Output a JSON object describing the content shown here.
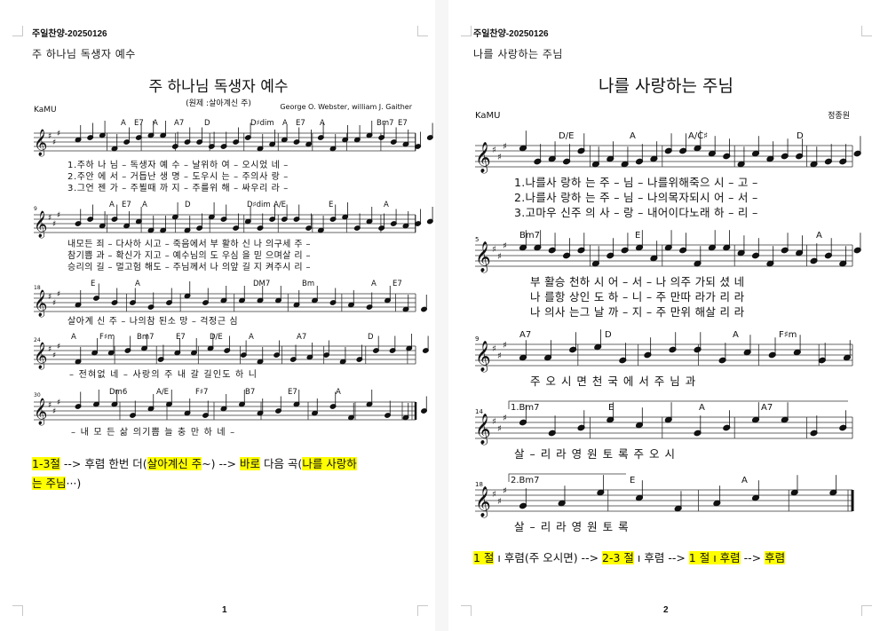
{
  "page1": {
    "header": "주일찬양-20250126",
    "subtitle": "주 하나님 독생자 예수",
    "title": "주 하나님 독생자 예수",
    "original": "(원제 :살아계신 주)",
    "publisher": "KaMU",
    "composer": "George O. Webster, william J. Gaither",
    "measure_numbers": [
      "9",
      "18",
      "24",
      "30"
    ],
    "chords": {
      "row1": [
        "A",
        "E7",
        "A",
        "A7",
        "D",
        "D♯dim",
        "A",
        "E7",
        "A",
        "Bm7",
        "E7"
      ],
      "row2": [
        "A",
        "E7",
        "A",
        "D",
        "D♯dim",
        "A/E",
        "E",
        "A"
      ],
      "row3": [
        "E",
        "A",
        "DM7",
        "Bm",
        "A",
        "E7"
      ],
      "row4": [
        "A",
        "F♯m",
        "Bm7",
        "E7",
        "D/E",
        "A",
        "A7",
        "D"
      ],
      "row5": [
        "Dm6",
        "A/E",
        "F♯7",
        "B7",
        "E7",
        "A"
      ]
    },
    "lyrics": {
      "row1": [
        "1.주하 나 님 – 독생자 예 수 – 날위하 여 – 오시었 네 –",
        "2.주안 에 서 – 거듭난 생 명 – 도우시 는 – 주의사 랑 –",
        "3.그언 젠 가 – 주뵐때 까 지 – 주를위 해 – 싸우리 라 –"
      ],
      "row2": [
        "내모든 죄 – 다사하 시고 – 죽음에서 부 활하 신 나 의구세 주 –",
        "참기쁨 과 – 확신가 지고 – 예수님의 도 우심 을 믿 으며살 리 –",
        "승리의 길 – 멀고험 해도 – 주님께서 나 의앞 길 지 켜주시 리 –"
      ],
      "row3": [
        "살아계 신 주  – 나의참 된소 망 – 걱정근 심"
      ],
      "row4": [
        "– 전혀없 네  – 사랑의 주 내 갈 길인도 하 니"
      ],
      "row5": [
        "– 내 모 든 삶  의기쁨  늘 충 만 하 네 –"
      ]
    },
    "note": {
      "p1": "1-3절",
      "p2": " -->  후렴 한번 더(",
      "p3": "살아계신 주",
      "p4": "~)  -->  ",
      "p5": "바로",
      "p6": " 다음 곡(",
      "p7": "나를 사랑하",
      "p8": "는 주님",
      "p9": "···)"
    },
    "page_number": "1"
  },
  "page2": {
    "header": "주일찬양-20250126",
    "subtitle": "나를 사랑하는 주님",
    "title": "나를 사랑하는 주님",
    "publisher": "KaMU",
    "composer": "정종원",
    "measure_numbers": [
      "5",
      "9",
      "14",
      "18"
    ],
    "chords": {
      "row1": [
        "D/E",
        "A",
        "A/C♯",
        "D"
      ],
      "row2": [
        "Bm7",
        "E",
        "A"
      ],
      "row3": [
        "A7",
        "D",
        "A",
        "F♯m"
      ],
      "row4": [
        "1.Bm7",
        "E",
        "A",
        "A7"
      ],
      "row5": [
        "2.Bm7",
        "E",
        "A"
      ]
    },
    "lyrics": {
      "row1": [
        "1.나를사 랑하 는 주 – 님 –    나를위해죽으 시 – 고 –",
        "2.나를사 랑하 는 주 – 님 –    나의목자되시 어 – 서 –",
        "3.고마우 신주 의 사 – 랑 –    내어이다노래 하 – 리 –"
      ],
      "row2": [
        "부 활승 천하 시 어 – 서 –    나 의주 가되 셨 네",
        "나 를항 상인 도 하 – 니 –    주 만따 라가 리 라",
        "나 의사 는그 날 까 – 지 –    주 만위 해살 리 라"
      ],
      "row3": [
        "주 오 시  면      천 국 에  서      주 님 과"
      ],
      "row4": [
        "살  – 리 라      영 원 토  록      주 오 시"
      ],
      "row5": [
        "살  – 리 라      영 원 토  록"
      ]
    },
    "note": {
      "p1": "1 절",
      "p2": " ı 후렴(주 오시면) --> ",
      "p3": "2-3 절",
      "p4": " ı 후렴 --> ",
      "p5": "1 절 ı 후렴",
      "p6": " --> ",
      "p7": "후렴"
    },
    "page_number": "2"
  }
}
